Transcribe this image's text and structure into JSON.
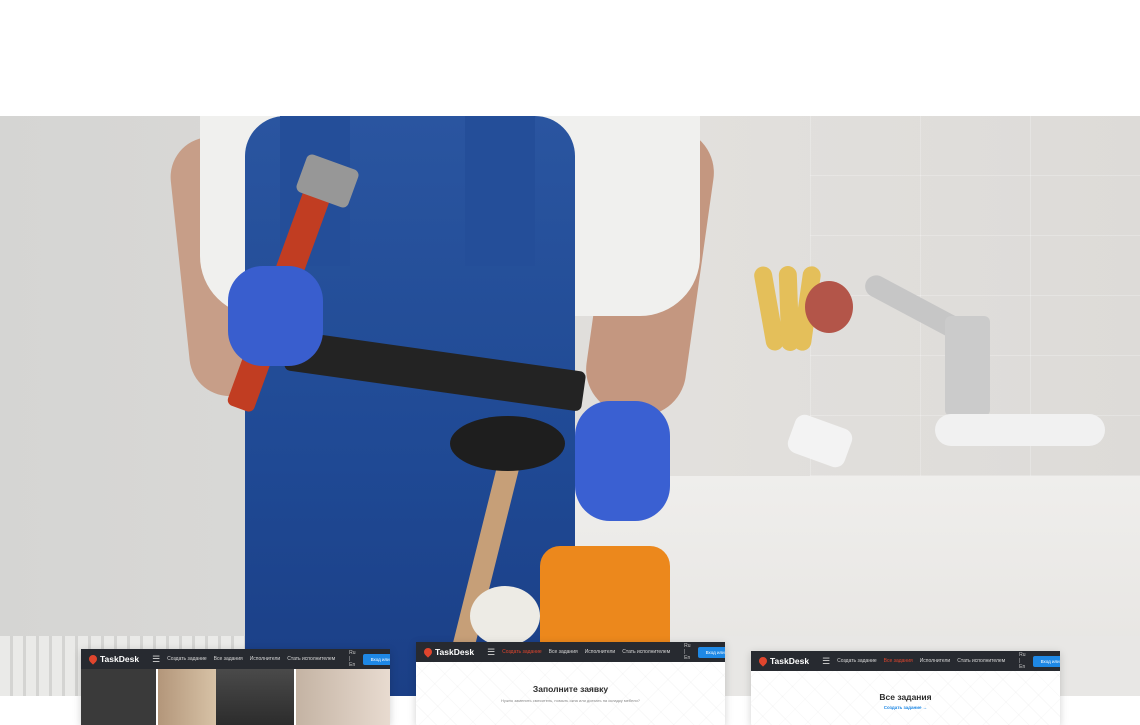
{
  "previews": [
    {
      "id": "home",
      "nav": {
        "logo": "TaskDesk",
        "links": [
          "Создать задание",
          "Все задания",
          "Исполнители",
          "Стать исполнителем"
        ],
        "active_index": -1,
        "lang": "Ru | En",
        "login": "Вход или Регистрация"
      }
    },
    {
      "id": "create-task",
      "nav": {
        "logo": "TaskDesk",
        "links": [
          "Создать задание",
          "Все задания",
          "Исполнители",
          "Стать исполнителем"
        ],
        "active_index": 0,
        "lang": "Ru | En",
        "login": "Вход или Регистрация"
      },
      "title": "Заполните заявку",
      "subtitle": "Нужно заменить смеситель, помыть окна или доехать на складку мебели?"
    },
    {
      "id": "all-tasks",
      "nav": {
        "logo": "TaskDesk",
        "links": [
          "Создать задание",
          "Все задания",
          "Исполнители",
          "Стать исполнителем"
        ],
        "active_index": 1,
        "lang": "Ru | En",
        "login": "Вход или Регистрация"
      },
      "title": "Все задания",
      "link": "Создать задание",
      "link_arrow": "→"
    }
  ],
  "colors": {
    "nav_bg": "#272a30",
    "accent": "#e0452d",
    "primary": "#1e88e5"
  },
  "icons": [
    "map-pin-icon",
    "menu-icon",
    "arrow-right-icon"
  ]
}
